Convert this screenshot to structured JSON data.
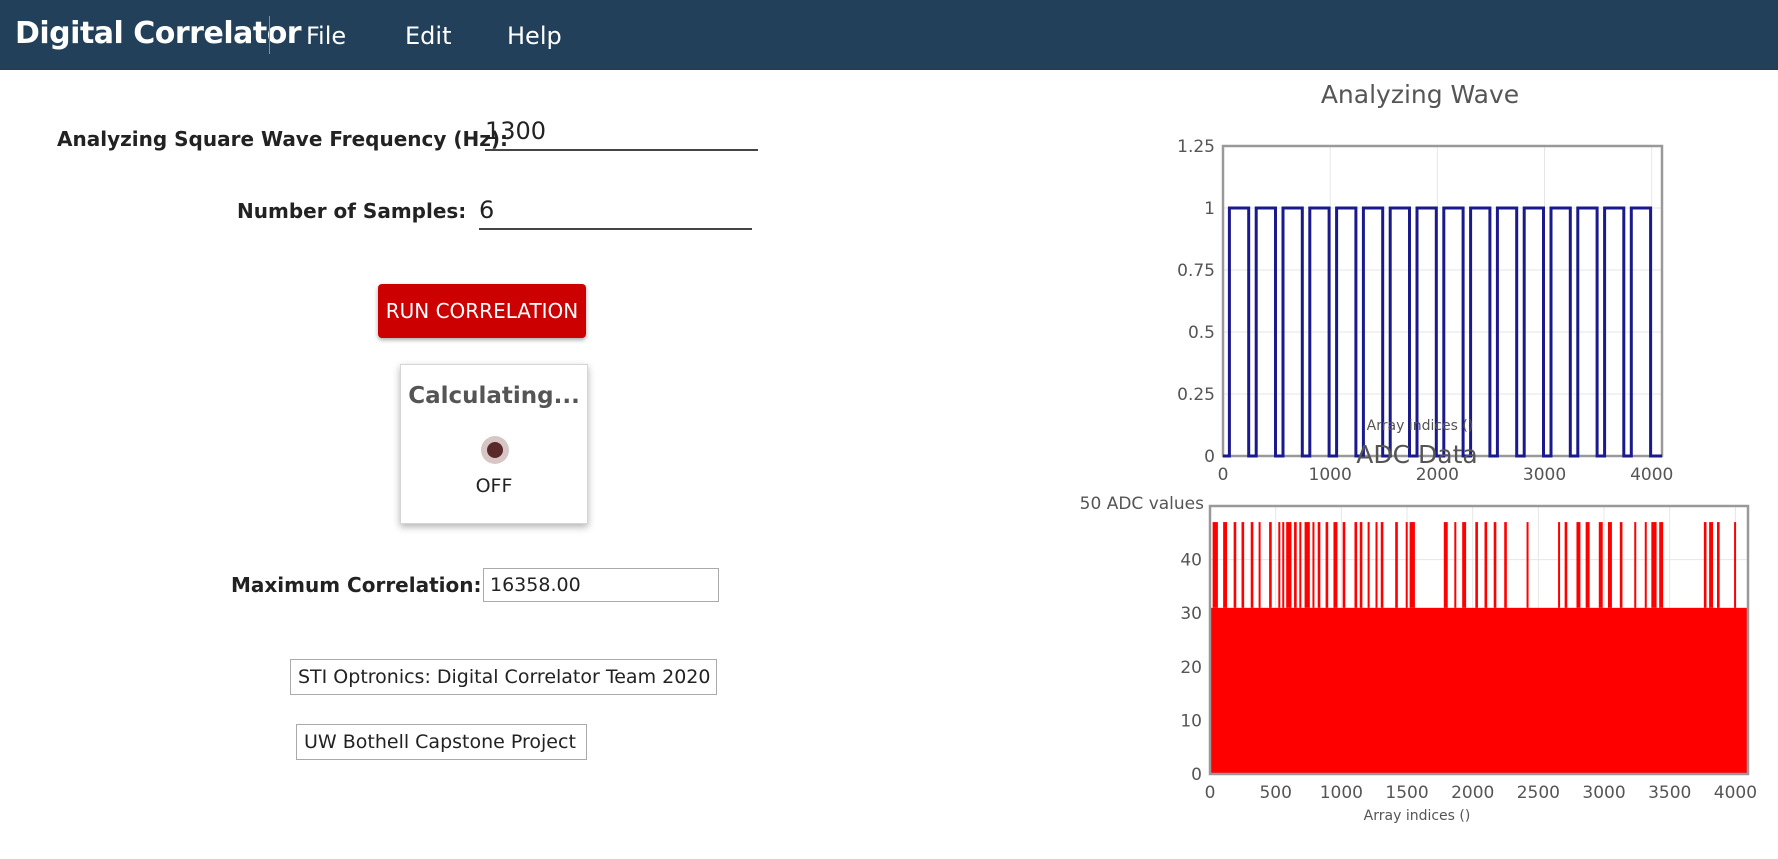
{
  "app": {
    "title": "Digital Correlator",
    "menu": [
      "File",
      "Edit",
      "Help"
    ]
  },
  "form": {
    "frequency_label": "Analyzing Square Wave Frequency (Hz):",
    "frequency_value": "1300",
    "samples_label": "Number of Samples:",
    "samples_value": "6",
    "run_button": "RUN CORRELATION",
    "max_corr_label": "Maximum Correlation:",
    "max_corr_value": "16358.00"
  },
  "status": {
    "title": "Calculating...",
    "state": "OFF"
  },
  "credits": {
    "team": "STI Optronics: Digital Correlator Team 2020",
    "project": "UW Bothell Capstone Project"
  },
  "colors": {
    "topbar": "#22405a",
    "run_button": "#cc0000",
    "wave_line": "#1a1a8c",
    "adc_fill": "#ff0000"
  },
  "chart_data": [
    {
      "type": "line",
      "title": "Analyzing Wave",
      "xlabel": "Array indices ()",
      "ylabel": "",
      "xlim": [
        0,
        4096
      ],
      "ylim": [
        0,
        1.25
      ],
      "xticks": [
        "0",
        "1000",
        "2000",
        "3000",
        "4000"
      ],
      "yticks": [
        "0",
        "0.25",
        "0.5",
        "0.75",
        "1",
        "1.25"
      ],
      "grid": true,
      "color": "#1a1a8c",
      "series": [
        {
          "x": [
            0,
            60,
            60,
            240,
            240,
            310,
            310,
            490,
            490,
            560,
            560,
            740,
            740,
            810,
            810,
            990,
            990,
            1060,
            1060,
            1240,
            1240,
            1310,
            1310,
            1490,
            1490,
            1560,
            1560,
            1740,
            1740,
            1810,
            1810,
            1990,
            1990,
            2060,
            2060,
            2240,
            2240,
            2310,
            2310,
            2490,
            2490,
            2560,
            2560,
            2740,
            2740,
            2810,
            2810,
            2990,
            2990,
            3060,
            3060,
            3240,
            3240,
            3310,
            3310,
            3490,
            3490,
            3560,
            3560,
            3740,
            3740,
            3810,
            3810,
            3990,
            3990,
            4096
          ],
          "y": [
            0,
            0,
            1,
            1,
            0,
            0,
            1,
            1,
            0,
            0,
            1,
            1,
            0,
            0,
            1,
            1,
            0,
            0,
            1,
            1,
            0,
            0,
            1,
            1,
            0,
            0,
            1,
            1,
            0,
            0,
            1,
            1,
            0,
            0,
            1,
            1,
            0,
            0,
            1,
            1,
            0,
            0,
            1,
            1,
            0,
            0,
            1,
            1,
            0,
            0,
            1,
            1,
            0,
            0,
            1,
            1,
            0,
            0,
            1,
            1,
            0,
            0,
            1,
            1,
            0,
            0
          ]
        }
      ]
    },
    {
      "type": "area",
      "title": "ADC Data",
      "xlabel": "Array indices ()",
      "ylabel": "50 ADC values",
      "xlim": [
        0,
        4096
      ],
      "ylim": [
        0,
        50
      ],
      "xticks": [
        "0",
        "500",
        "1000",
        "1500",
        "2000",
        "2500",
        "3000",
        "3500",
        "4000"
      ],
      "yticks": [
        "0",
        "10",
        "20",
        "30",
        "40"
      ],
      "grid": true,
      "color": "#ff0000",
      "baseline": 31,
      "series": [
        {
          "spikes": [
            [
              20,
              60
            ],
            [
              100,
              130
            ],
            [
              180,
              200
            ],
            [
              240,
              260
            ],
            [
              310,
              330
            ],
            [
              370,
              380
            ],
            [
              450,
              470
            ],
            [
              520,
              530
            ],
            [
              550,
              560
            ],
            [
              580,
              620
            ],
            [
              640,
              660
            ],
            [
              680,
              690
            ],
            [
              720,
              760
            ],
            [
              780,
              790
            ],
            [
              820,
              840
            ],
            [
              880,
              900
            ],
            [
              940,
              970
            ],
            [
              1010,
              1030
            ],
            [
              1100,
              1120
            ],
            [
              1140,
              1160
            ],
            [
              1200,
              1210
            ],
            [
              1260,
              1270
            ],
            [
              1300,
              1320
            ],
            [
              1410,
              1430
            ],
            [
              1490,
              1500
            ],
            [
              1520,
              1560
            ],
            [
              1780,
              1810
            ],
            [
              1860,
              1870
            ],
            [
              1920,
              1950
            ],
            [
              2020,
              2040
            ],
            [
              2090,
              2110
            ],
            [
              2160,
              2180
            ],
            [
              2240,
              2260
            ],
            [
              2410,
              2420
            ],
            [
              2650,
              2660
            ],
            [
              2700,
              2720
            ],
            [
              2790,
              2820
            ],
            [
              2860,
              2890
            ],
            [
              2960,
              2990
            ],
            [
              3030,
              3060
            ],
            [
              3120,
              3140
            ],
            [
              3230,
              3240
            ],
            [
              3310,
              3320
            ],
            [
              3360,
              3400
            ],
            [
              3420,
              3450
            ],
            [
              3760,
              3780
            ],
            [
              3800,
              3830
            ],
            [
              3860,
              3880
            ],
            [
              3990,
              4000
            ]
          ],
          "spike_value": 47
        }
      ]
    }
  ]
}
